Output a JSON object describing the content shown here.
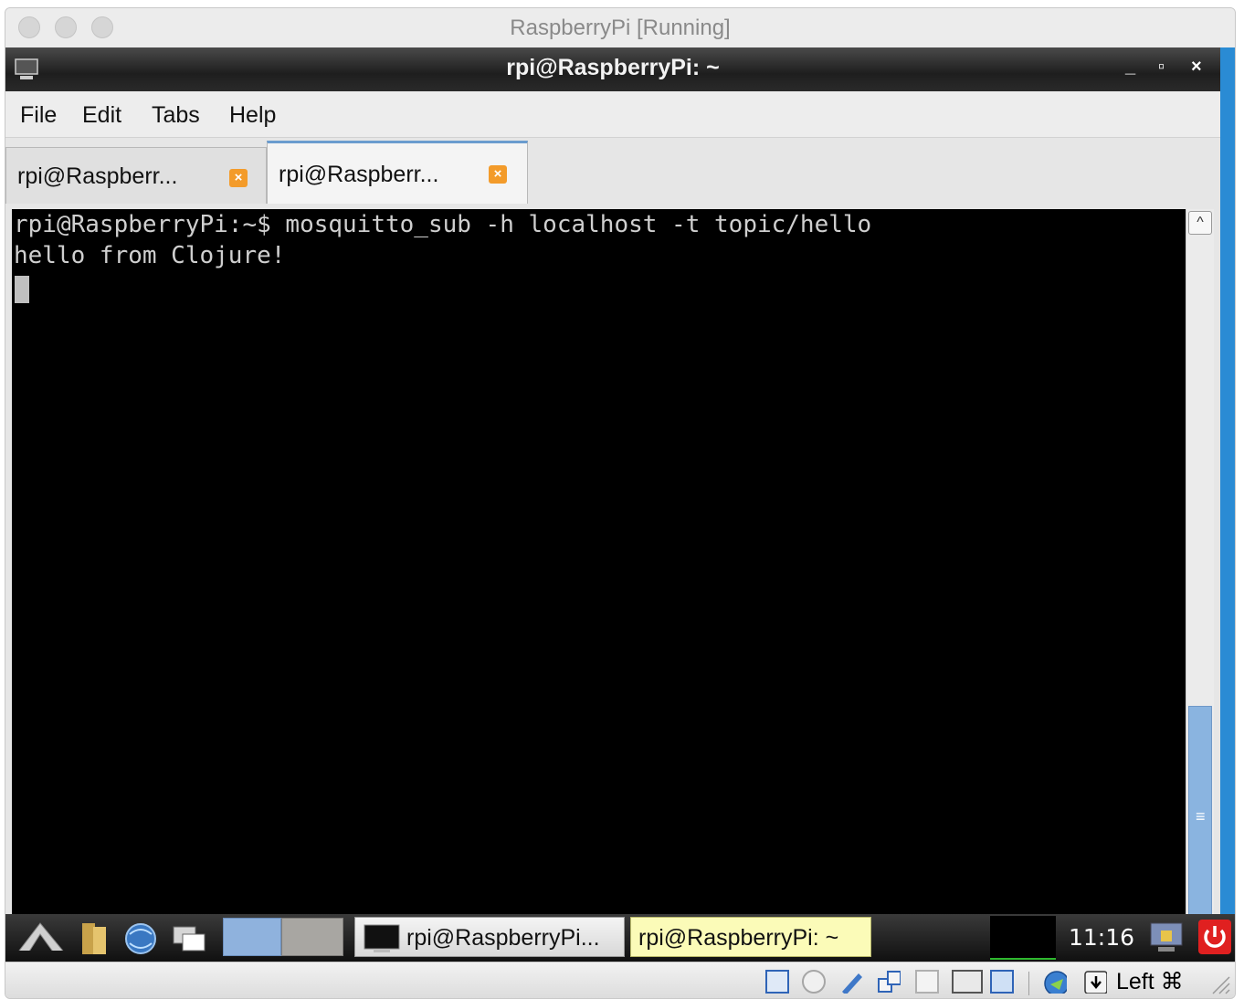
{
  "host_window": {
    "title": "RaspberryPi [Running]"
  },
  "guest_window": {
    "title": "rpi@RaspberryPi: ~",
    "controls": {
      "minimize": "_",
      "maximize": "▫",
      "close": "×"
    }
  },
  "menu": {
    "items": [
      "File",
      "Edit",
      "Tabs",
      "Help"
    ]
  },
  "tabs": [
    {
      "label": "rpi@Raspberr...",
      "active": false,
      "close_icon": "close-tab-icon"
    },
    {
      "label": "rpi@Raspberr...",
      "active": true,
      "close_icon": "close-tab-icon"
    }
  ],
  "terminal": {
    "lines": [
      "rpi@RaspberryPi:~$ mosquitto_sub -h localhost -t topic/hello",
      "hello from Clojure!"
    ]
  },
  "scrollbar": {
    "up_arrow": "^",
    "grip": "≡"
  },
  "taskbar": {
    "launchers": [
      "menu-icon",
      "file-manager-icon",
      "browser-icon",
      "window-switcher-icon"
    ],
    "tasks": [
      {
        "label": "rpi@RaspberryPi...",
        "active": true
      },
      {
        "label": "rpi@RaspberryPi: ~",
        "active": false
      }
    ],
    "clock": "11:16",
    "tray": [
      "cpu-monitor-icon",
      "lock-screen-icon",
      "power-icon"
    ]
  },
  "vbox_status": {
    "icons": [
      "hard-disk-icon",
      "optical-drive-icon",
      "usb-icon",
      "network-icon",
      "shared-folder-icon",
      "display-icon",
      "video-capture-icon",
      "cpu-icon",
      "mouse-integration-icon",
      "keyboard-icon"
    ],
    "host_key": "Left ⌘"
  },
  "colors": {
    "tab_close": "#f39b2a",
    "accent": "#2a8bd4",
    "power": "#e02020"
  }
}
